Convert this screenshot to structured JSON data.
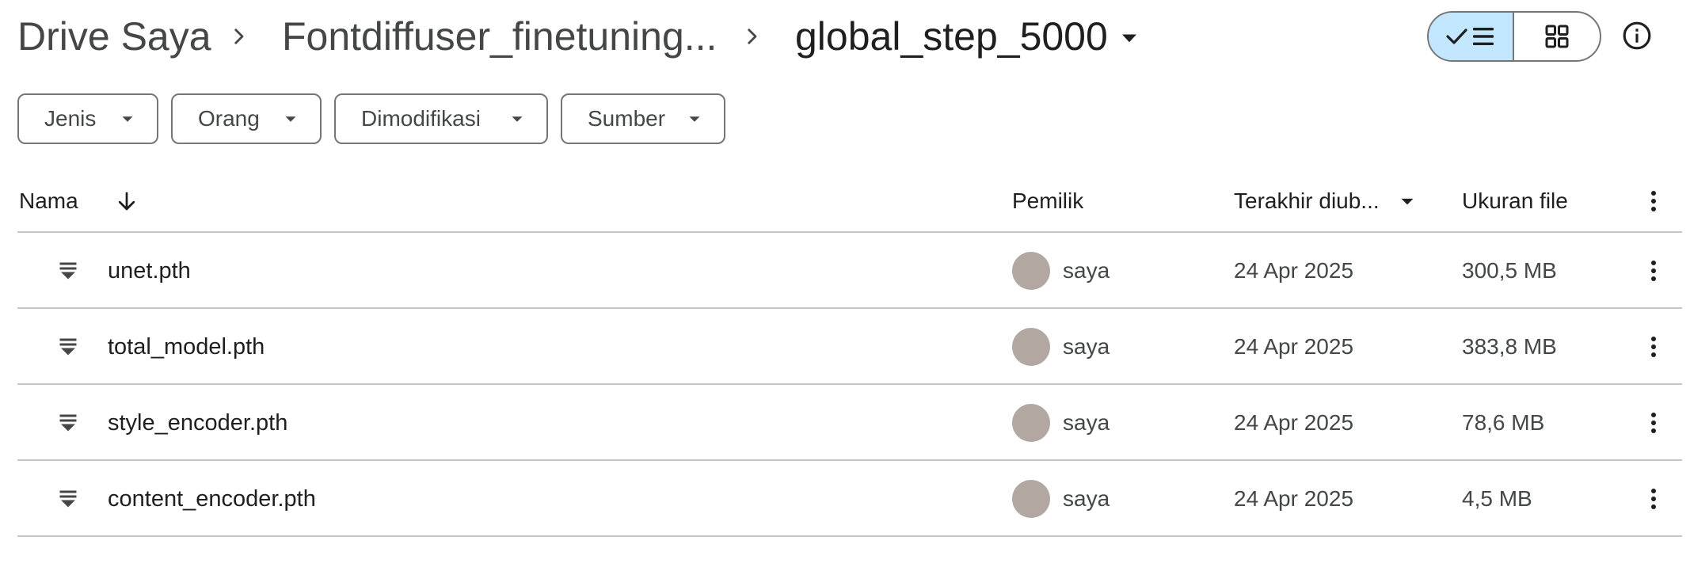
{
  "breadcrumb": {
    "root": "Drive Saya",
    "parent": "Fontdiffuser_finetuning...",
    "current": "global_step_5000"
  },
  "view_toggle": {
    "list_icon": "check-list-icon",
    "grid_icon": "grid-icon",
    "active": "list"
  },
  "info_icon": "info-icon",
  "filters": [
    {
      "label": "Jenis"
    },
    {
      "label": "Orang"
    },
    {
      "label": "Dimodifikasi"
    },
    {
      "label": "Sumber"
    }
  ],
  "table": {
    "columns": {
      "name": "Nama",
      "owner": "Pemilik",
      "modified": "Terakhir diub...",
      "size": "Ukuran file"
    },
    "sort_icon": "arrow-down-icon",
    "rows": [
      {
        "name": "unet.pth",
        "owner": "saya",
        "modified": "24 Apr 2025",
        "size": "300,5 MB"
      },
      {
        "name": "total_model.pth",
        "owner": "saya",
        "modified": "24 Apr 2025",
        "size": "383,8 MB"
      },
      {
        "name": "style_encoder.pth",
        "owner": "saya",
        "modified": "24 Apr 2025",
        "size": "78,6 MB"
      },
      {
        "name": "content_encoder.pth",
        "owner": "saya",
        "modified": "24 Apr 2025",
        "size": "4,5 MB"
      }
    ]
  },
  "colors": {
    "active_toggle_bg": "#c2e7ff",
    "avatar": "#b3a7a1",
    "divider": "#c4c7c5",
    "text_primary": "#1f1f1f",
    "text_secondary": "#444746"
  }
}
